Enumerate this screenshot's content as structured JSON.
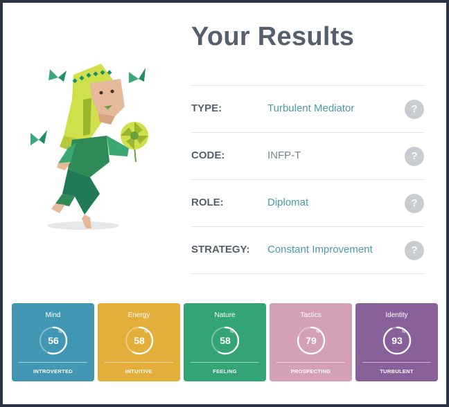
{
  "header": {
    "title": "Your Results"
  },
  "results": [
    {
      "label": "TYPE:",
      "value": "Turbulent Mediator",
      "help": "?"
    },
    {
      "label": "CODE:",
      "value": "INFP-T",
      "help": "?"
    },
    {
      "label": "ROLE:",
      "value": "Diplomat",
      "help": "?"
    },
    {
      "label": "STRATEGY:",
      "value": "Constant Improvement",
      "help": "?"
    }
  ],
  "traits": [
    {
      "name": "Mind",
      "percent": "56",
      "percent_sign": "%",
      "trait": "INTROVERTED",
      "color": "#4298b4"
    },
    {
      "name": "Energy",
      "percent": "58",
      "percent_sign": "%",
      "trait": "INTUITIVE",
      "color": "#e4ae3a"
    },
    {
      "name": "Nature",
      "percent": "58",
      "percent_sign": "%",
      "trait": "FEELING",
      "color": "#33a474"
    },
    {
      "name": "Tactics",
      "percent": "79",
      "percent_sign": "%",
      "trait": "PROSPECTING",
      "color": "#d4a0b8"
    },
    {
      "name": "Identity",
      "percent": "93",
      "percent_sign": "%",
      "trait": "TURBULENT",
      "color": "#88619a"
    }
  ],
  "colors": {
    "title": "#555f6d",
    "link": "#4a9ab0",
    "help_bg": "#c9ccd1",
    "frame_border": "#2b3442"
  },
  "icons": {
    "avatar": "mediator-character-illustration",
    "help": "question-circle-icon"
  }
}
